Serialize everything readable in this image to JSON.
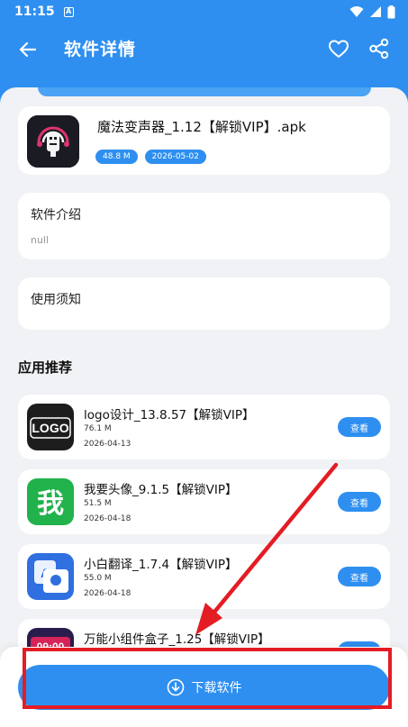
{
  "status_bar": {
    "time": "11:15",
    "notif_icon": "A"
  },
  "app_bar": {
    "title": "软件详情",
    "back_icon": "back-arrow-icon",
    "fav_icon": "heart-icon",
    "share_icon": "share-icon"
  },
  "app": {
    "name": "魔法变声器_1.12【解锁VIP】.apk",
    "size": "48.8 M",
    "date": "2026-05-02"
  },
  "intro": {
    "heading": "软件介绍",
    "value": "null"
  },
  "notice": {
    "heading": "使用须知"
  },
  "recommend": {
    "title": "应用推荐",
    "items": [
      {
        "name": "logo设计_13.8.57【解锁VIP】",
        "size": "76.1 M",
        "date": "2026-04-13",
        "button": "查看",
        "icon_text": "LOGO"
      },
      {
        "name": "我要头像_9.1.5【解锁VIP】",
        "size": "51.5 M",
        "date": "2026-04-18",
        "button": "查看",
        "icon_text": "我"
      },
      {
        "name": "小白翻译_1.7.4【解锁VIP】",
        "size": "55.0 M",
        "date": "2026-04-18",
        "button": "查看",
        "icon_text": "A"
      },
      {
        "name": "万能小组件盒子_1.25【解锁VIP】",
        "size": "",
        "date": "",
        "button": "查看",
        "icon_text": "09:00"
      }
    ]
  },
  "download": {
    "label": "下载软件"
  },
  "colors": {
    "primary": "#2e8ff0",
    "annotation": "#e41c24",
    "background": "#f1f2f5"
  }
}
